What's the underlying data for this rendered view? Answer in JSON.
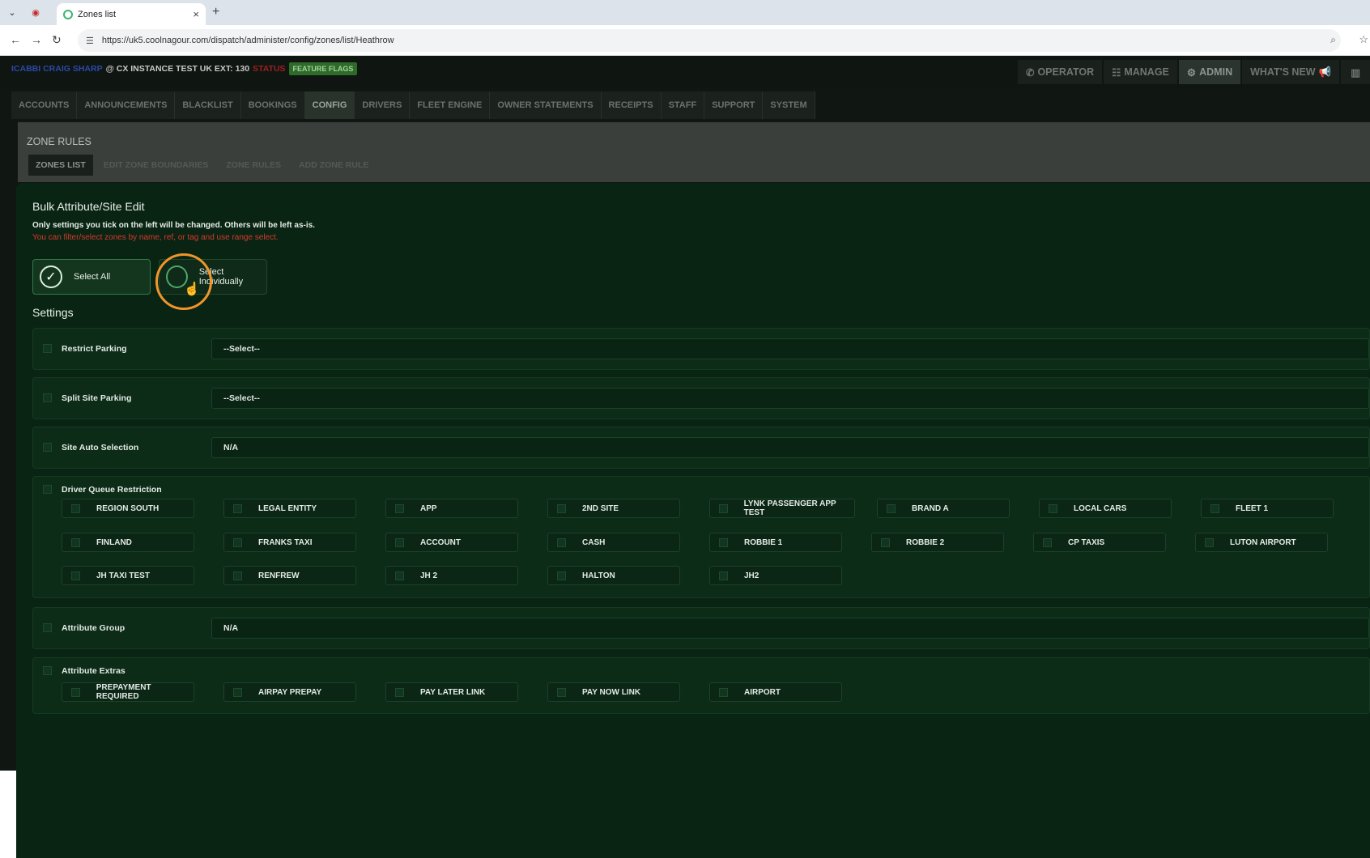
{
  "browser": {
    "tab_title": "Zones list",
    "tab_close": "×",
    "new_tab": "+",
    "url": "https://uk5.coolnagour.com/dispatch/administer/config/zones/list/Heathrow"
  },
  "header": {
    "user": "ICABBI CRAIG SHARP",
    "instance": "@ CX INSTANCE TEST UK EXT: 130",
    "status": "STATUS",
    "feature_flags": "FEATURE FLAGS",
    "nav": [
      "OPERATOR",
      "MANAGE",
      "ADMIN",
      "WHAT'S NEW"
    ]
  },
  "module_tabs": [
    "ACCOUNTS",
    "ANNOUNCEMENTS",
    "BLACKLIST",
    "BOOKINGS",
    "CONFIG",
    "DRIVERS",
    "FLEET ENGINE",
    "OWNER STATEMENTS",
    "RECEIPTS",
    "STAFF",
    "SUPPORT",
    "SYSTEM"
  ],
  "zone_rules": {
    "title": "ZONE RULES",
    "subtabs": [
      "ZONES LIST",
      "EDIT ZONE BOUNDARIES",
      "ZONE RULES",
      "ADD ZONE RULE"
    ]
  },
  "modal": {
    "title": "Bulk Attribute/Site Edit",
    "note": "Only settings you tick on the left will be changed. Others will be left as-is.",
    "note_red": "You can filter/select zones by name, ref, or tag and use range select.",
    "select_all": "Select All",
    "select_individually": "Select Individually",
    "settings_heading": "Settings",
    "restrict_parking": {
      "label": "Restrict Parking",
      "value": "--Select--"
    },
    "split_site_parking": {
      "label": "Split Site Parking",
      "value": "--Select--"
    },
    "site_auto_selection": {
      "label": "Site Auto Selection",
      "value": "N/A"
    },
    "driver_queue_restriction": {
      "label": "Driver Queue Restriction",
      "options": [
        "REGION SOUTH",
        "LEGAL ENTITY",
        "APP",
        "2ND SITE",
        "LYNK PASSENGER APP TEST",
        "BRAND A",
        "LOCAL CARS",
        "FLEET 1",
        "FINLAND",
        "FRANKS TAXI",
        "ACCOUNT",
        "CASH",
        "ROBBIE 1",
        "ROBBIE 2",
        "CP TAXIS",
        "LUTON AIRPORT",
        "JH TAXI TEST",
        "RENFREW",
        "JH 2",
        "HALTON",
        "JH2"
      ]
    },
    "attribute_group": {
      "label": "Attribute Group",
      "value": "N/A"
    },
    "attribute_extras": {
      "label": "Attribute Extras",
      "options": [
        "PREPAYMENT REQUIRED",
        "AIRPAY PREPAY",
        "PAY LATER LINK",
        "PAY NOW LINK",
        "AIRPORT"
      ]
    }
  },
  "colors": {
    "accent_highlight": "#f0952a",
    "modal_bg": "#0a2414",
    "error_text": "#d33a2a"
  },
  "icons": [
    "chevron-down-icon",
    "record-icon",
    "back-icon",
    "forward-icon",
    "reload-icon",
    "site-settings-icon",
    "zoom-icon",
    "star-icon",
    "phone-icon",
    "list-icon",
    "gear-icon",
    "megaphone-icon",
    "chart-icon",
    "check-icon",
    "cursor-hand-icon"
  ]
}
